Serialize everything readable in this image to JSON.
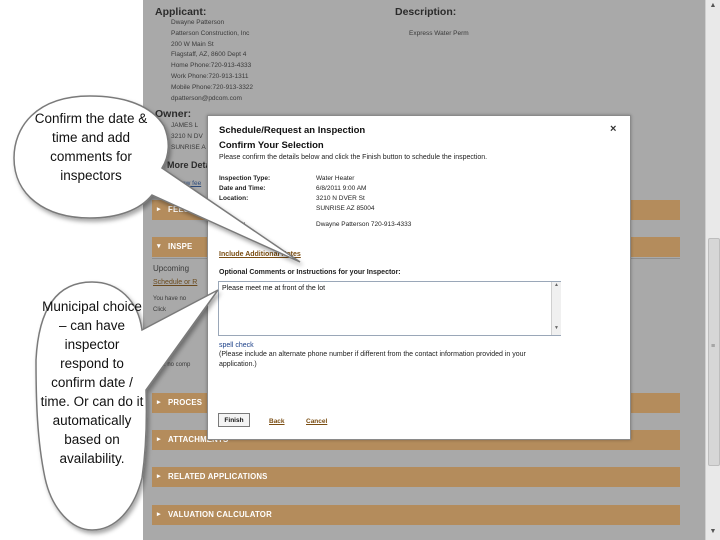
{
  "applicant": {
    "heading": "Applicant:",
    "lines": [
      "Dwayne Patterson",
      "Patterson Construction, Inc",
      "200 W Main St",
      "Flagstaff, AZ, 8600 Dept 4",
      "Home Phone:720-913-4333",
      "Work Phone:720-913-1311",
      "Mobile Phone:720-913-3322",
      "dpatterson@pdcom.com"
    ]
  },
  "description": {
    "heading": "Description:",
    "value": "Express Water Perm"
  },
  "owner": {
    "heading": "Owner:",
    "lines": [
      "JAMES L",
      "3210 N DV",
      "SUNRISE A"
    ]
  },
  "more_details": "More Deta",
  "link_fragment": "PrintView  fee",
  "bands": [
    "FEES",
    "INSPE",
    "PROCES",
    "ATTACHMENTS",
    "RELATED APPLICATIONS",
    "VALUATION CALCULATOR"
  ],
  "upcoming": "Upcoming",
  "schedule_fragment": "Schedule or R",
  "fragments": [
    "You have no",
    "Click",
    "pleted",
    "are no comp"
  ],
  "modal": {
    "title": "Schedule/Request an Inspection",
    "close_glyph": "×",
    "subtitle": "Confirm Your Selection",
    "instructions": "Please confirm the details below and click the Finish button to schedule the inspection.",
    "details": [
      {
        "label": "Inspection Type:",
        "value": "Water Heater"
      },
      {
        "label": "Date and Time:",
        "value": "6/8/2011 9:00 AM"
      },
      {
        "label": "Location:",
        "value": "3210 N DVER St"
      },
      {
        "label": "",
        "value": "SUNRISE AZ 85004"
      },
      {
        "label": "Contact:",
        "value": "Dwayne Patterson 720-913-4333"
      }
    ],
    "include_link": "Include Additional Notes",
    "optional_label": "Optional Comments or Instructions for your Inspector:",
    "textarea_value": "Please meet me at front of the lot",
    "spell_check": "spell check",
    "note": "(Please include an alternate phone number if different from the contact information provided in your application.)",
    "finish": "Finish",
    "back": "Back",
    "cancel": "Cancel"
  },
  "callouts": {
    "top": "Confirm the date & time and add comments for inspectors",
    "bottom": "Municipal choice – can have inspector respond to confirm date / time.  Or can do it automatically based on availability."
  },
  "colors": {
    "band": "#b48c5c",
    "overlay": "#a9a9a9",
    "link": "#7a4d12"
  }
}
